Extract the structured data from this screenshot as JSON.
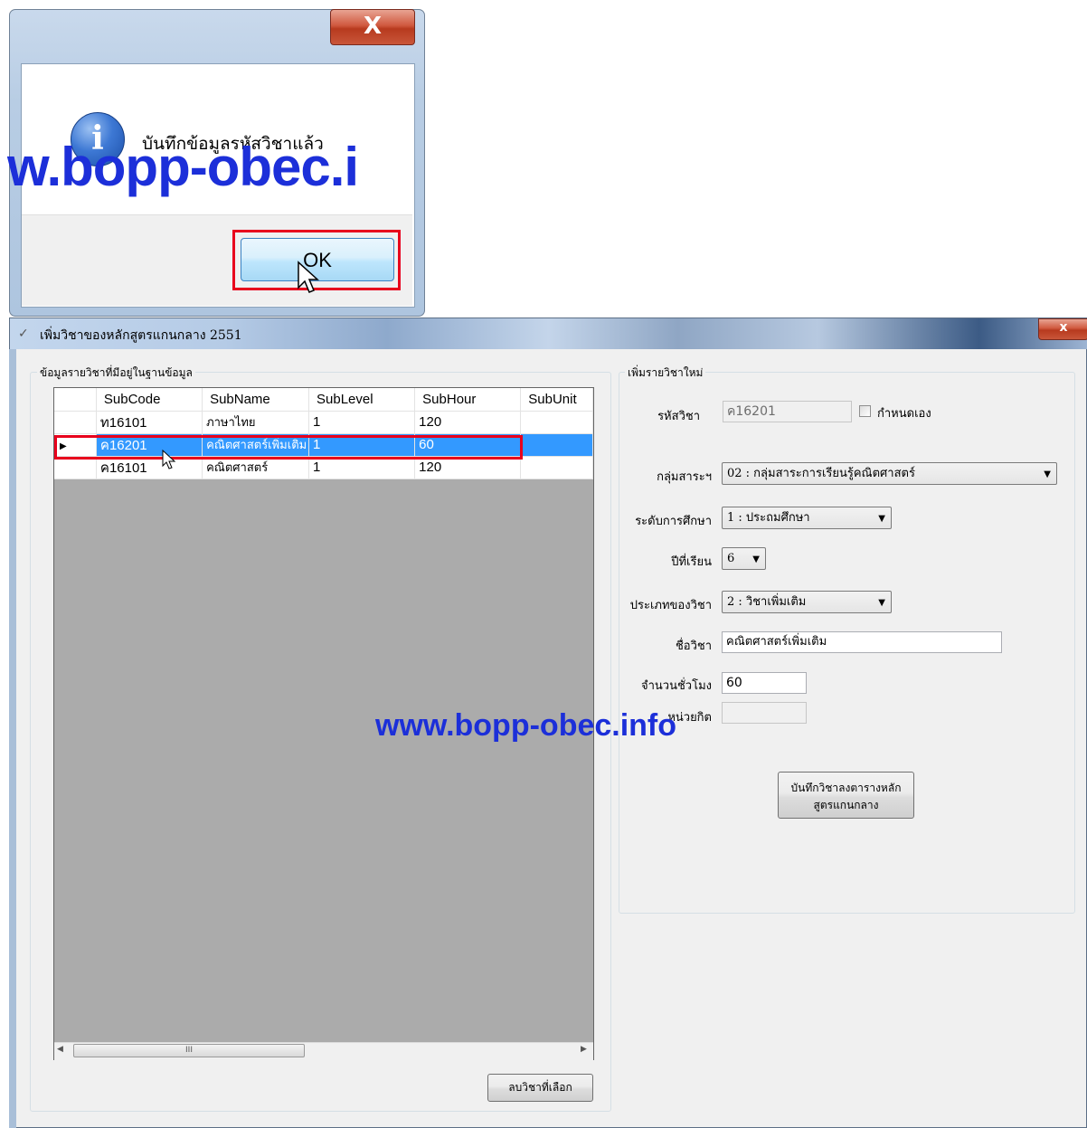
{
  "message_box": {
    "close_glyph": "X",
    "icon": "info-icon",
    "icon_glyph": "i",
    "message": "บันทึกข้อมูลรหัสวิชาแล้ว",
    "watermark": "w.bopp-obec.i",
    "ok_label": "OK"
  },
  "window": {
    "title": "เพิ่มวิชาของหลักสูตรแกนกลาง 2551",
    "close_glyph": "x",
    "left_group": {
      "label": "ข้อมูลรายวิชาที่มีอยู่ในฐานข้อมูล",
      "columns": [
        "SubCode",
        "SubName",
        "SubLevel",
        "SubHour",
        "SubUnit"
      ],
      "rows": [
        {
          "code": "ท16101",
          "name": "ภาษาไทย",
          "level": "1",
          "hour": "120",
          "unit": ""
        },
        {
          "code": "ค16201",
          "name": "คณิตศาสตร์เพิ่มเติม",
          "level": "1",
          "hour": "60",
          "unit": ""
        },
        {
          "code": "ค16101",
          "name": "คณิตศาสตร์",
          "level": "1",
          "hour": "120",
          "unit": ""
        }
      ],
      "selected_row": 1,
      "scroll_thumb_glyph": "III",
      "delete_button": "ลบวิชาที่เลือก"
    },
    "right_group": {
      "label": "เพิ่มรายวิชาใหม่",
      "fields": {
        "code_label": "รหัสวิชา",
        "code_value": "ค16201",
        "custom_checkbox_label": "กำหนดเอง",
        "custom_checkbox_checked": false,
        "group_label": "กลุ่มสาระฯ",
        "group_value": "02 : กลุ่มสาระการเรียนรู้คณิตศาสตร์",
        "level_label": "ระดับการศึกษา",
        "level_value": "1 : ประถมศึกษา",
        "year_label": "ปีที่เรียน",
        "year_value": "6",
        "type_label": "ประเภทของวิชา",
        "type_value": "2 : วิชาเพิ่มเติม",
        "name_label": "ชื่อวิชา",
        "name_value": "คณิตศาสตร์เพิ่มเติม",
        "hours_label": "จำนวนชั่วโมง",
        "hours_value": "60",
        "unit_label": "หน่วยกิต",
        "unit_value": ""
      },
      "save_button_line1": "บันทึกวิชาลงตารางหลัก",
      "save_button_line2": "สูตรแกนกลาง"
    },
    "watermark": "www.bopp-obec.info"
  },
  "colors": {
    "selection": "#3399ff",
    "highlight_box": "#e8001c",
    "watermark": "#1c2fd9"
  }
}
